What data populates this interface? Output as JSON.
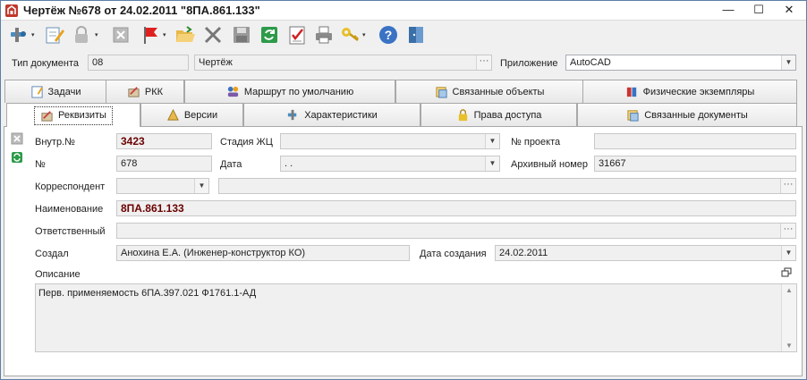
{
  "window": {
    "title": "Чертёж №678 от 24.02.2011 \"8ПА.861.133\"",
    "min_glyph": "—",
    "max_glyph": "☐",
    "close_glyph": "✕"
  },
  "toolbar": {
    "icons": [
      "tools-icon",
      "edit-icon",
      "lock-icon",
      "delete-icon",
      "flag-icon",
      "open-folder-icon",
      "cross-icon",
      "save-icon",
      "refresh-icon",
      "checklist-icon",
      "print-icon",
      "key-icon",
      "help-icon",
      "exit-icon"
    ]
  },
  "doc_type": {
    "label": "Тип документа",
    "code": "08",
    "name": "Чертёж",
    "app_label": "Приложение",
    "app_value": "AutoCAD"
  },
  "tabs_row1": [
    {
      "label": "Задачи",
      "icon": "tasks-icon"
    },
    {
      "label": "РКК",
      "icon": "rkk-icon"
    },
    {
      "label": "Маршрут по умолчанию",
      "icon": "route-icon"
    },
    {
      "label": "Связанные объекты",
      "icon": "linked-objects-icon"
    },
    {
      "label": "Физические экземпляры",
      "icon": "physical-copies-icon"
    }
  ],
  "tabs_row2": [
    {
      "label": "Реквизиты",
      "icon": "requisites-icon"
    },
    {
      "label": "Версии",
      "icon": "versions-icon"
    },
    {
      "label": "Характеристики",
      "icon": "characteristics-icon"
    },
    {
      "label": "Права доступа",
      "icon": "access-rights-icon"
    },
    {
      "label": "Связанные документы",
      "icon": "linked-docs-icon"
    }
  ],
  "form": {
    "internal_no_label": "Внутр.№",
    "internal_no": "3423",
    "stage_label": "Стадия ЖЦ",
    "stage_value": "",
    "project_no_label": "№ проекта",
    "project_no": "",
    "no_label": "№",
    "no_value": "678",
    "date_label": "Дата",
    "date_value": " .  .",
    "archive_no_label": "Архивный номер",
    "archive_no": "31667",
    "correspondent_label": "Корреспондент",
    "correspondent_value": "",
    "name_label": "Наименование",
    "name_value": "8ПА.861.133",
    "responsible_label": "Ответственный",
    "responsible_value": "",
    "created_by_label": "Создал",
    "created_by_value": "Анохина  Е.А. (Инженер-конструктор КО)",
    "created_date_label": "Дата создания",
    "created_date_value": "24.02.2011",
    "description_label": "Описание",
    "description_value": "Перв. применяемость 6ПА.397.021 Ф1761.1-АД"
  },
  "glyphs": {
    "dropdown": "▼",
    "ellipsis": "···",
    "up": "▲",
    "down": "▼",
    "small_dd": "▾"
  }
}
